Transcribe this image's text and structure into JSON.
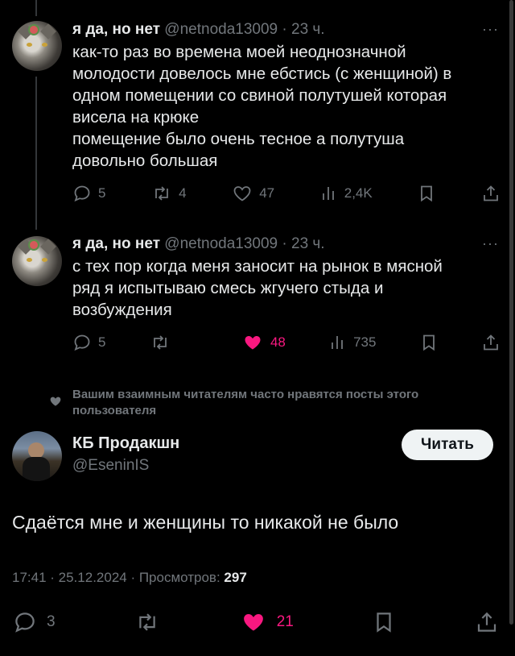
{
  "tweets": [
    {
      "name": "я да, но нет",
      "handle": "@netnoda13009",
      "time": "· 23 ч.",
      "more": "···",
      "lines": [
        "как-то раз во времена моей неоднозначной",
        "молодости довелось мне ебстись (с женщиной) в",
        "одном помещении со свиной полутушей которая",
        "висела на крюке",
        "помещение было очень тесное а полутуша",
        "довольно большая"
      ],
      "replies": "5",
      "reposts": "4",
      "likes": "47",
      "views": "2,4K",
      "liked": false
    },
    {
      "name": "я да, но нет",
      "handle": "@netnoda13009",
      "time": "· 23 ч.",
      "more": "···",
      "lines": [
        "с тех пор когда меня заносит на рынок в мясной",
        "ряд я  испытываю смесь жгучего стыда и",
        "возбуждения"
      ],
      "replies": "5",
      "reposts": "",
      "likes": "48",
      "views": "735",
      "liked": true
    }
  ],
  "social_context": {
    "line1": "Вашим взаимным читателям часто нравятся посты этого",
    "line2": "пользователя"
  },
  "main": {
    "name": "КБ Продакшн",
    "handle": "@EseninIS",
    "follow_label": "Читать",
    "text": "Сдаётся мне и женщины то никакой не было",
    "date": "17:41 · 25.12.2024 · Просмотров: ",
    "views": "297",
    "replies": "3",
    "likes": "21"
  },
  "colors": {
    "background": "#000000",
    "text": "#e7e9ea",
    "secondary": "#71767b",
    "like": "#f91880"
  }
}
